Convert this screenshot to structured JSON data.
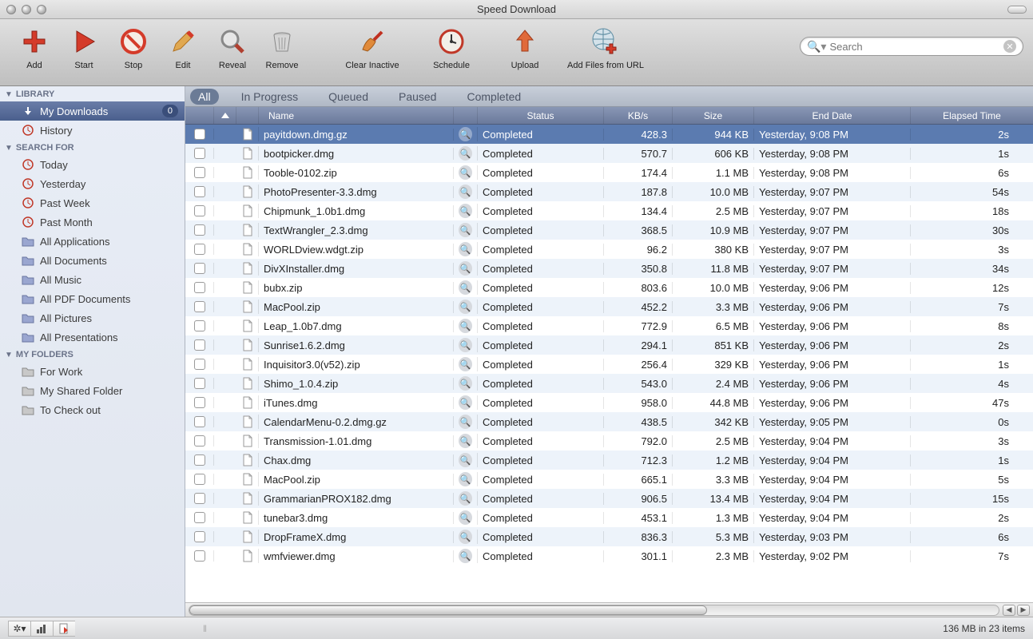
{
  "window": {
    "title": "Speed Download"
  },
  "toolbar": {
    "add": "Add",
    "start": "Start",
    "stop": "Stop",
    "edit": "Edit",
    "reveal": "Reveal",
    "remove": "Remove",
    "clear_inactive": "Clear Inactive",
    "schedule": "Schedule",
    "upload": "Upload",
    "add_url": "Add Files from URL"
  },
  "search": {
    "placeholder": "Search"
  },
  "sidebar": {
    "sections": {
      "library": "LIBRARY",
      "search_for": "SEARCH FOR",
      "my_folders": "MY FOLDERS"
    },
    "library": [
      {
        "label": "My Downloads",
        "badge": "0",
        "selected": true
      },
      {
        "label": "History"
      }
    ],
    "search_for": [
      {
        "label": "Today"
      },
      {
        "label": "Yesterday"
      },
      {
        "label": "Past Week"
      },
      {
        "label": "Past Month"
      },
      {
        "label": "All Applications"
      },
      {
        "label": "All Documents"
      },
      {
        "label": "All Music"
      },
      {
        "label": "All PDF Documents"
      },
      {
        "label": "All Pictures"
      },
      {
        "label": "All Presentations"
      }
    ],
    "my_folders": [
      {
        "label": "For Work"
      },
      {
        "label": "My Shared Folder"
      },
      {
        "label": "To Check out"
      }
    ]
  },
  "filters": {
    "all": "All",
    "in_progress": "In Progress",
    "queued": "Queued",
    "paused": "Paused",
    "completed": "Completed"
  },
  "columns": {
    "name": "Name",
    "status": "Status",
    "kbs": "KB/s",
    "size": "Size",
    "end_date": "End Date",
    "elapsed": "Elapsed Time"
  },
  "rows": [
    {
      "name": "payitdown.dmg.gz",
      "status": "Completed",
      "kbs": "428.3",
      "size": "944 KB",
      "date": "Yesterday, 9:08 PM",
      "elapsed": "2s",
      "selected": true
    },
    {
      "name": "bootpicker.dmg",
      "status": "Completed",
      "kbs": "570.7",
      "size": "606 KB",
      "date": "Yesterday, 9:08 PM",
      "elapsed": "1s"
    },
    {
      "name": "Tooble-0102.zip",
      "status": "Completed",
      "kbs": "174.4",
      "size": "1.1 MB",
      "date": "Yesterday, 9:08 PM",
      "elapsed": "6s"
    },
    {
      "name": "PhotoPresenter-3.3.dmg",
      "status": "Completed",
      "kbs": "187.8",
      "size": "10.0 MB",
      "date": "Yesterday, 9:07 PM",
      "elapsed": "54s"
    },
    {
      "name": "Chipmunk_1.0b1.dmg",
      "status": "Completed",
      "kbs": "134.4",
      "size": "2.5 MB",
      "date": "Yesterday, 9:07 PM",
      "elapsed": "18s"
    },
    {
      "name": "TextWrangler_2.3.dmg",
      "status": "Completed",
      "kbs": "368.5",
      "size": "10.9 MB",
      "date": "Yesterday, 9:07 PM",
      "elapsed": "30s"
    },
    {
      "name": "WORLDview.wdgt.zip",
      "status": "Completed",
      "kbs": "96.2",
      "size": "380 KB",
      "date": "Yesterday, 9:07 PM",
      "elapsed": "3s"
    },
    {
      "name": "DivXInstaller.dmg",
      "status": "Completed",
      "kbs": "350.8",
      "size": "11.8 MB",
      "date": "Yesterday, 9:07 PM",
      "elapsed": "34s"
    },
    {
      "name": "bubx.zip",
      "status": "Completed",
      "kbs": "803.6",
      "size": "10.0 MB",
      "date": "Yesterday, 9:06 PM",
      "elapsed": "12s"
    },
    {
      "name": "MacPool.zip",
      "status": "Completed",
      "kbs": "452.2",
      "size": "3.3 MB",
      "date": "Yesterday, 9:06 PM",
      "elapsed": "7s"
    },
    {
      "name": "Leap_1.0b7.dmg",
      "status": "Completed",
      "kbs": "772.9",
      "size": "6.5 MB",
      "date": "Yesterday, 9:06 PM",
      "elapsed": "8s"
    },
    {
      "name": "Sunrise1.6.2.dmg",
      "status": "Completed",
      "kbs": "294.1",
      "size": "851 KB",
      "date": "Yesterday, 9:06 PM",
      "elapsed": "2s"
    },
    {
      "name": "Inquisitor3.0(v52).zip",
      "status": "Completed",
      "kbs": "256.4",
      "size": "329 KB",
      "date": "Yesterday, 9:06 PM",
      "elapsed": "1s"
    },
    {
      "name": "Shimo_1.0.4.zip",
      "status": "Completed",
      "kbs": "543.0",
      "size": "2.4 MB",
      "date": "Yesterday, 9:06 PM",
      "elapsed": "4s"
    },
    {
      "name": "iTunes.dmg",
      "status": "Completed",
      "kbs": "958.0",
      "size": "44.8 MB",
      "date": "Yesterday, 9:06 PM",
      "elapsed": "47s"
    },
    {
      "name": "CalendarMenu-0.2.dmg.gz",
      "status": "Completed",
      "kbs": "438.5",
      "size": "342 KB",
      "date": "Yesterday, 9:05 PM",
      "elapsed": "0s"
    },
    {
      "name": "Transmission-1.01.dmg",
      "status": "Completed",
      "kbs": "792.0",
      "size": "2.5 MB",
      "date": "Yesterday, 9:04 PM",
      "elapsed": "3s"
    },
    {
      "name": "Chax.dmg",
      "status": "Completed",
      "kbs": "712.3",
      "size": "1.2 MB",
      "date": "Yesterday, 9:04 PM",
      "elapsed": "1s"
    },
    {
      "name": "MacPool.zip",
      "status": "Completed",
      "kbs": "665.1",
      "size": "3.3 MB",
      "date": "Yesterday, 9:04 PM",
      "elapsed": "5s"
    },
    {
      "name": "GrammarianPROX182.dmg",
      "status": "Completed",
      "kbs": "906.5",
      "size": "13.4 MB",
      "date": "Yesterday, 9:04 PM",
      "elapsed": "15s"
    },
    {
      "name": "tunebar3.dmg",
      "status": "Completed",
      "kbs": "453.1",
      "size": "1.3 MB",
      "date": "Yesterday, 9:04 PM",
      "elapsed": "2s"
    },
    {
      "name": "DropFrameX.dmg",
      "status": "Completed",
      "kbs": "836.3",
      "size": "5.3 MB",
      "date": "Yesterday, 9:03 PM",
      "elapsed": "6s"
    },
    {
      "name": "wmfviewer.dmg",
      "status": "Completed",
      "kbs": "301.1",
      "size": "2.3 MB",
      "date": "Yesterday, 9:02 PM",
      "elapsed": "7s"
    }
  ],
  "statusbar": {
    "summary": "136 MB in 23 items"
  }
}
